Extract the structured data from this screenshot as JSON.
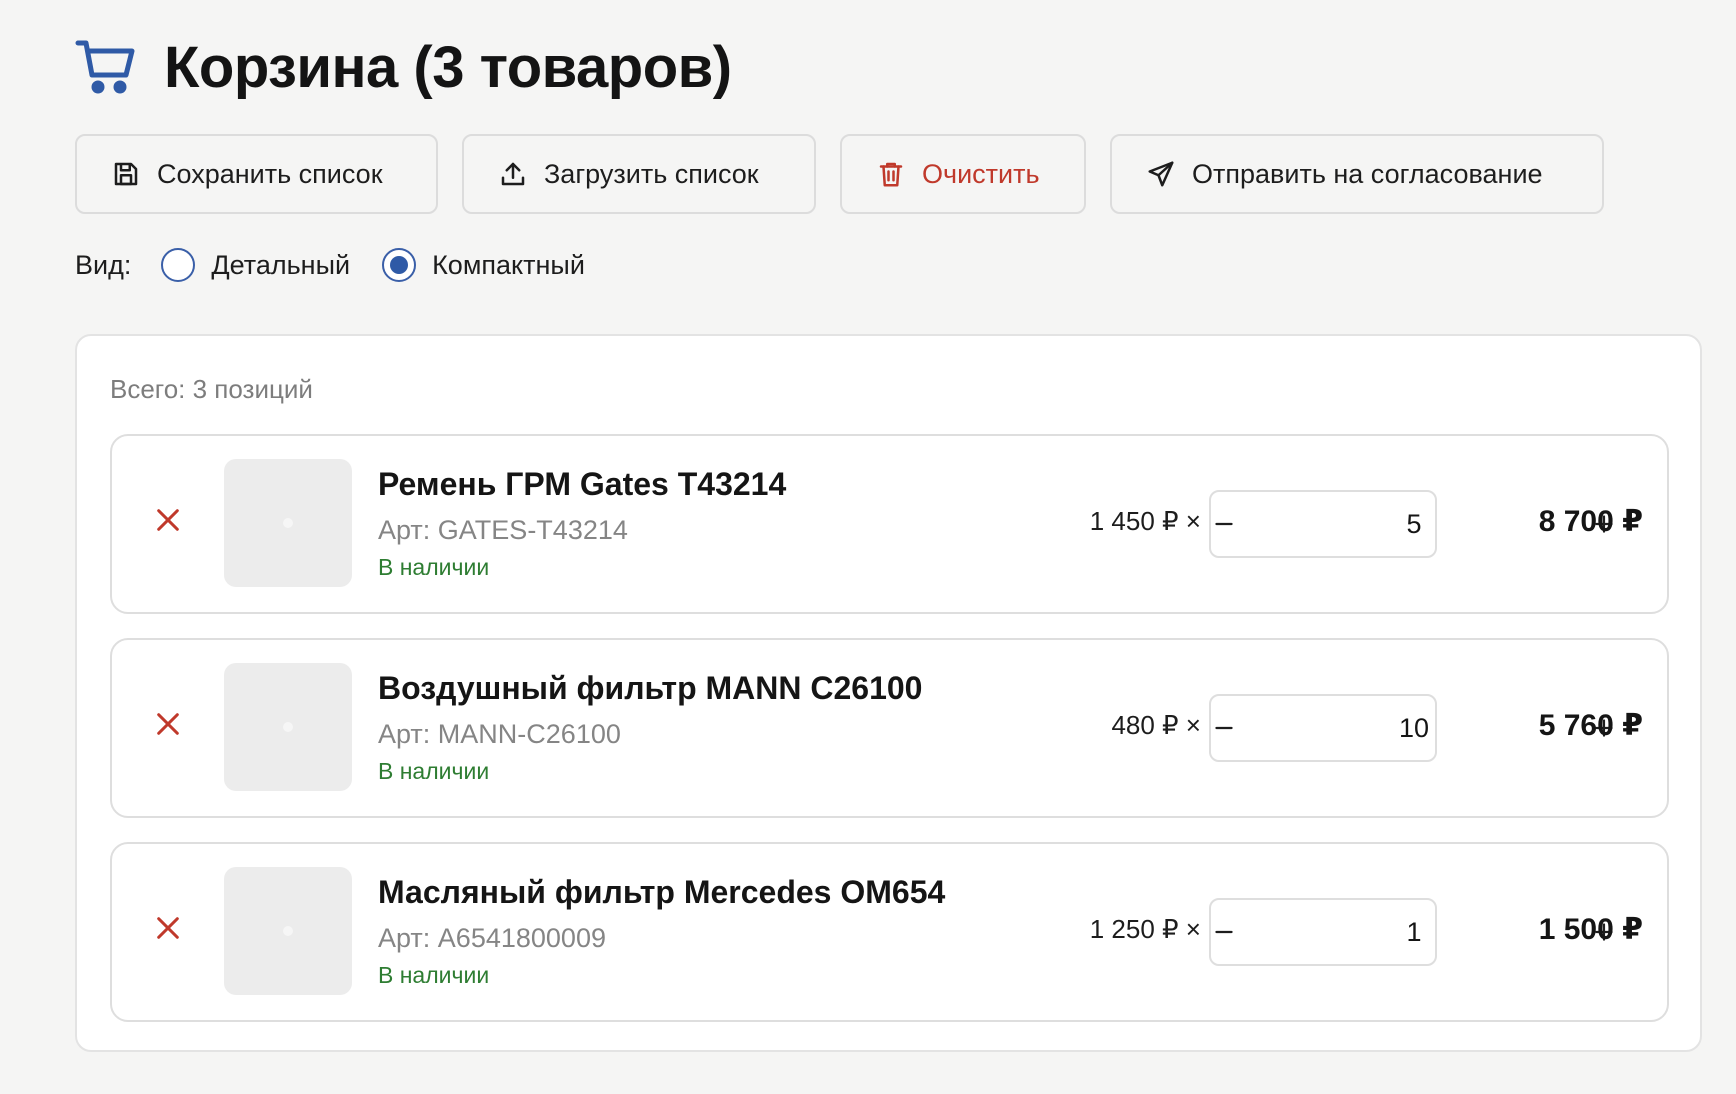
{
  "header": {
    "title": "Корзина (3 товаров)",
    "icon": "cart-icon",
    "icon_color": "#2f5aa6"
  },
  "toolbar": {
    "save_label": "Сохранить список",
    "upload_label": "Загрузить список",
    "clear_label": "Очистить",
    "send_label": "Отправить на согласование",
    "danger_color": "#c0392b"
  },
  "view": {
    "label": "Вид:",
    "options": [
      {
        "label": "Детальный",
        "selected": false
      },
      {
        "label": "Компактный",
        "selected": true
      }
    ]
  },
  "cart": {
    "total_label": "Всего: 3 позиций",
    "items": [
      {
        "name": "Ремень ГРМ Gates T43214",
        "sku": "Арт: GATES-T43214",
        "stock": "В наличии",
        "unit_price": "1 450 ₽ ×",
        "quantity": "5",
        "line_total": "8 700 ₽"
      },
      {
        "name": "Воздушный фильтр MANN C26100",
        "sku": "Арт: MANN-C26100",
        "stock": "В наличии",
        "unit_price": "480 ₽ ×",
        "quantity": "10",
        "line_total": "5 760 ₽"
      },
      {
        "name": "Масляный фильтр Mercedes OM654",
        "sku": "Арт: A6541800009",
        "stock": "В наличии",
        "unit_price": "1 250 ₽ ×",
        "quantity": "1",
        "line_total": "1 500 ₽"
      }
    ]
  },
  "colors": {
    "accent": "#2f5aa6",
    "stock_green": "#2e7d32",
    "remove_red": "#c0392b"
  }
}
